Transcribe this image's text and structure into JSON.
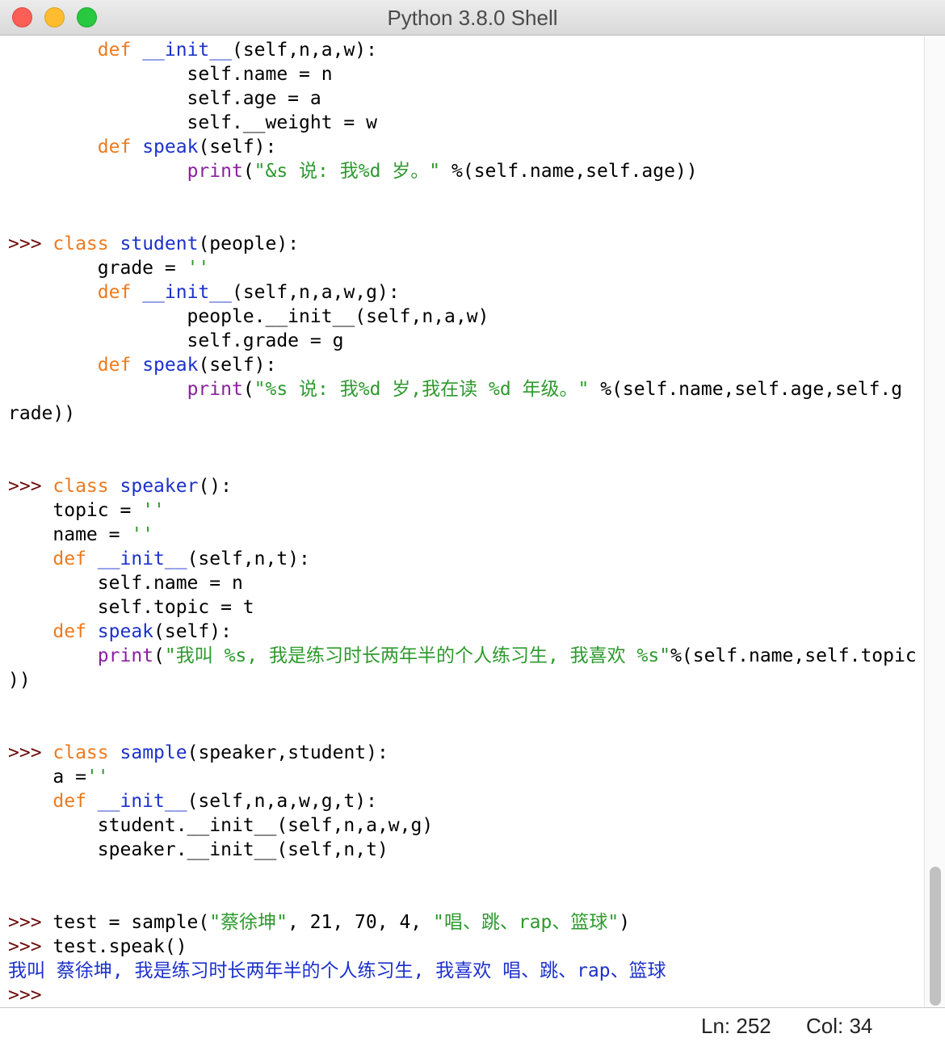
{
  "window": {
    "title": "Python 3.8.0 Shell"
  },
  "colors": {
    "keyword": "#ee7a1e",
    "definition": "#1c31cc",
    "builtin": "#8b1fa1",
    "string": "#2d9a2d",
    "prompt": "#6e0b0b",
    "stdout": "#1c31cc"
  },
  "shell": {
    "lines": [
      [
        {
          "t": "        "
        },
        {
          "t": "def",
          "c": "kw"
        },
        {
          "t": " "
        },
        {
          "t": "__init__",
          "c": "def"
        },
        {
          "t": "(self,n,a,w):"
        }
      ],
      [
        {
          "t": "                self.name = n"
        }
      ],
      [
        {
          "t": "                self.age = a"
        }
      ],
      [
        {
          "t": "                self.__weight = w"
        }
      ],
      [
        {
          "t": "        "
        },
        {
          "t": "def",
          "c": "kw"
        },
        {
          "t": " "
        },
        {
          "t": "speak",
          "c": "def"
        },
        {
          "t": "(self):"
        }
      ],
      [
        {
          "t": "                "
        },
        {
          "t": "print",
          "c": "bi"
        },
        {
          "t": "("
        },
        {
          "t": "\"&s 说: 我%d 岁。\"",
          "c": "str"
        },
        {
          "t": " %(self.name,self.age))"
        }
      ],
      [],
      [],
      [
        {
          "t": ">>> ",
          "c": "prompt"
        },
        {
          "t": "class",
          "c": "kw"
        },
        {
          "t": " "
        },
        {
          "t": "student",
          "c": "def"
        },
        {
          "t": "(people):"
        }
      ],
      [
        {
          "t": "        grade = "
        },
        {
          "t": "''",
          "c": "str"
        }
      ],
      [
        {
          "t": "        "
        },
        {
          "t": "def",
          "c": "kw"
        },
        {
          "t": " "
        },
        {
          "t": "__init__",
          "c": "def"
        },
        {
          "t": "(self,n,a,w,g):"
        }
      ],
      [
        {
          "t": "                people.__init__(self,n,a,w)"
        }
      ],
      [
        {
          "t": "                self.grade = g"
        }
      ],
      [
        {
          "t": "        "
        },
        {
          "t": "def",
          "c": "kw"
        },
        {
          "t": " "
        },
        {
          "t": "speak",
          "c": "def"
        },
        {
          "t": "(self):"
        }
      ],
      [
        {
          "t": "                "
        },
        {
          "t": "print",
          "c": "bi"
        },
        {
          "t": "("
        },
        {
          "t": "\"%s 说: 我%d 岁,我在读 %d 年级。\"",
          "c": "str"
        },
        {
          "t": " %(self.name,self.age,self.g"
        }
      ],
      [
        {
          "t": "rade))"
        }
      ],
      [],
      [],
      [
        {
          "t": ">>> ",
          "c": "prompt"
        },
        {
          "t": "class",
          "c": "kw"
        },
        {
          "t": " "
        },
        {
          "t": "speaker",
          "c": "def"
        },
        {
          "t": "():"
        }
      ],
      [
        {
          "t": "    topic = "
        },
        {
          "t": "''",
          "c": "str"
        }
      ],
      [
        {
          "t": "    name = "
        },
        {
          "t": "''",
          "c": "str"
        }
      ],
      [
        {
          "t": "    "
        },
        {
          "t": "def",
          "c": "kw"
        },
        {
          "t": " "
        },
        {
          "t": "__init__",
          "c": "def"
        },
        {
          "t": "(self,n,t):"
        }
      ],
      [
        {
          "t": "        self.name = n"
        }
      ],
      [
        {
          "t": "        self.topic = t"
        }
      ],
      [
        {
          "t": "    "
        },
        {
          "t": "def",
          "c": "kw"
        },
        {
          "t": " "
        },
        {
          "t": "speak",
          "c": "def"
        },
        {
          "t": "(self):"
        }
      ],
      [
        {
          "t": "        "
        },
        {
          "t": "print",
          "c": "bi"
        },
        {
          "t": "("
        },
        {
          "t": "\"我叫 %s, 我是练习时长两年半的个人练习生, 我喜欢 %s\"",
          "c": "str"
        },
        {
          "t": "%(self.name,self.topic"
        }
      ],
      [
        {
          "t": "))"
        }
      ],
      [],
      [],
      [
        {
          "t": ">>> ",
          "c": "prompt"
        },
        {
          "t": "class",
          "c": "kw"
        },
        {
          "t": " "
        },
        {
          "t": "sample",
          "c": "def"
        },
        {
          "t": "(speaker,student):"
        }
      ],
      [
        {
          "t": "    a ="
        },
        {
          "t": "''",
          "c": "str"
        }
      ],
      [
        {
          "t": "    "
        },
        {
          "t": "def",
          "c": "kw"
        },
        {
          "t": " "
        },
        {
          "t": "__init__",
          "c": "def"
        },
        {
          "t": "(self,n,a,w,g,t):"
        }
      ],
      [
        {
          "t": "        student.__init__(self,n,a,w,g)"
        }
      ],
      [
        {
          "t": "        speaker.__init__(self,n,t)"
        }
      ],
      [],
      [],
      [
        {
          "t": ">>> ",
          "c": "prompt"
        },
        {
          "t": "test = sample("
        },
        {
          "t": "\"蔡徐坤\"",
          "c": "str"
        },
        {
          "t": ", 21, 70, 4, "
        },
        {
          "t": "\"唱、跳、rap、篮球\"",
          "c": "str"
        },
        {
          "t": ")"
        }
      ],
      [
        {
          "t": ">>> ",
          "c": "prompt"
        },
        {
          "t": "test.speak()"
        }
      ],
      [
        {
          "t": "我叫 蔡徐坤, 我是练习时长两年半的个人练习生, 我喜欢 唱、跳、rap、篮球",
          "c": "out"
        }
      ],
      [
        {
          "t": ">>> ",
          "c": "prompt"
        }
      ]
    ]
  },
  "status": {
    "line": "Ln: 252",
    "col": "Col: 34"
  }
}
